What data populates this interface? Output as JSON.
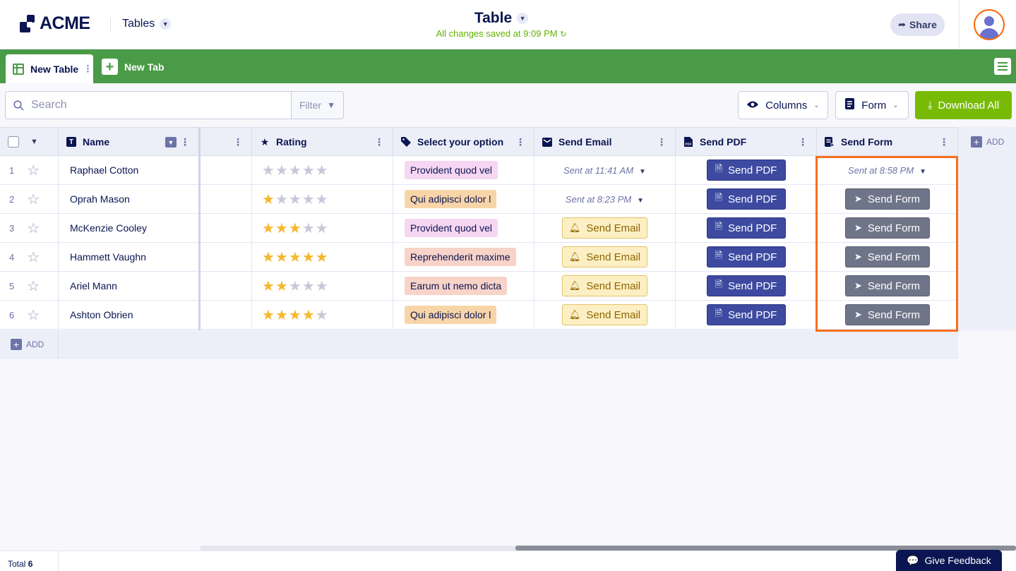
{
  "header": {
    "logo_text": "ACME",
    "tables_menu": "Tables",
    "title": "Table",
    "saved_status": "All changes saved at 9:09 PM",
    "share_label": "Share"
  },
  "tabs": {
    "active_tab": "New Table",
    "new_tab": "New Tab"
  },
  "toolbar": {
    "search_placeholder": "Search",
    "filter_label": "Filter",
    "columns_label": "Columns",
    "form_label": "Form",
    "download_label": "Download All"
  },
  "table": {
    "columns": {
      "name": "Name",
      "rating": "Rating",
      "option": "Select your option",
      "email": "Send Email",
      "pdf": "Send PDF",
      "form": "Send Form",
      "add": "ADD"
    },
    "rows": [
      {
        "num": "1",
        "name": "Raphael Cotton",
        "rating": 0,
        "option": "Provident quod vel",
        "option_color": "#f6d6f2",
        "email": {
          "type": "sent",
          "text": "Sent at 11:41 AM"
        },
        "pdf": "Send PDF",
        "form": {
          "type": "sent",
          "text": "Sent at 8:58 PM"
        }
      },
      {
        "num": "2",
        "name": "Oprah Mason",
        "rating": 1,
        "option": "Qui adipisci dolor l",
        "option_color": "#f8d5a8",
        "email": {
          "type": "sent",
          "text": "Sent at 8:23 PM"
        },
        "pdf": "Send PDF",
        "form": {
          "type": "button",
          "text": "Send Form"
        }
      },
      {
        "num": "3",
        "name": "McKenzie Cooley",
        "rating": 3,
        "option": "Provident quod vel",
        "option_color": "#f6d6f2",
        "email": {
          "type": "button",
          "text": "Send Email"
        },
        "pdf": "Send PDF",
        "form": {
          "type": "button",
          "text": "Send Form"
        }
      },
      {
        "num": "4",
        "name": "Hammett Vaughn",
        "rating": 5,
        "option": "Reprehenderit maxime",
        "option_color": "#f8d3c8",
        "email": {
          "type": "button",
          "text": "Send Email"
        },
        "pdf": "Send PDF",
        "form": {
          "type": "button",
          "text": "Send Form"
        }
      },
      {
        "num": "5",
        "name": "Ariel Mann",
        "rating": 2,
        "option": "Earum ut nemo dicta",
        "option_color": "#f8d3c8",
        "email": {
          "type": "button",
          "text": "Send Email"
        },
        "pdf": "Send PDF",
        "form": {
          "type": "button",
          "text": "Send Form"
        }
      },
      {
        "num": "6",
        "name": "Ashton Obrien",
        "rating": 4,
        "option": "Qui adipisci dolor l",
        "option_color": "#f8d5a8",
        "email": {
          "type": "button",
          "text": "Send Email"
        },
        "pdf": "Send PDF",
        "form": {
          "type": "button",
          "text": "Send Form"
        }
      }
    ],
    "add_row_label": "ADD",
    "max_rating": 5
  },
  "footer": {
    "total_label": "Total",
    "total_count": "6",
    "feedback_label": "Give Feedback"
  },
  "colors": {
    "brand_green": "#4a9b47",
    "download_green": "#78bb07",
    "navy": "#0a1551",
    "pdf_blue": "#3d4aa0",
    "highlight_orange": "#f6701d"
  }
}
